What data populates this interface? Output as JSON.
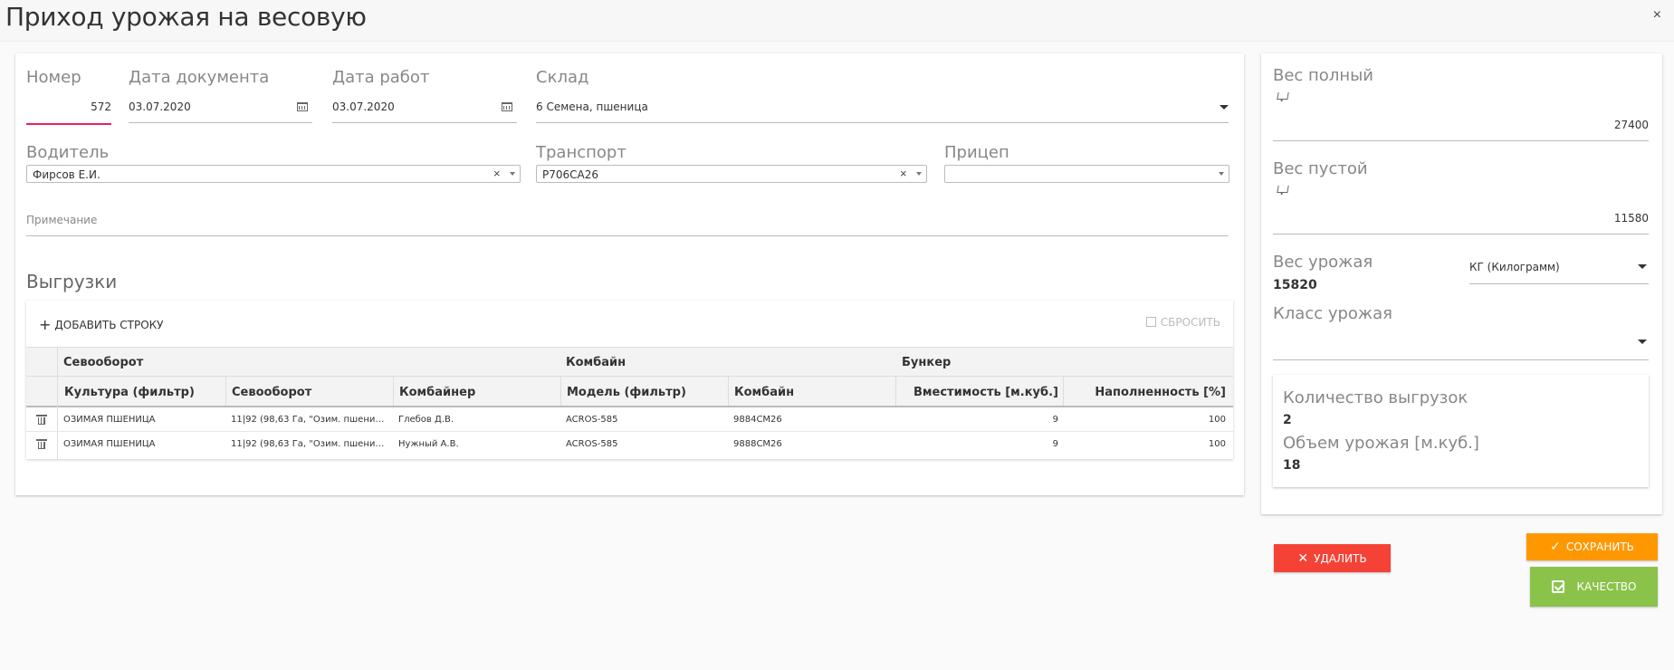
{
  "window": {
    "title": "Приход урожая на весовую",
    "close_label": "×"
  },
  "form": {
    "number": {
      "label": "Номер",
      "value": "572"
    },
    "doc_date": {
      "label": "Дата документа",
      "value": "03.07.2020"
    },
    "work_date": {
      "label": "Дата работ",
      "value": "03.07.2020"
    },
    "warehouse": {
      "label": "Склад",
      "value": "6 Семена, пшеница"
    },
    "driver": {
      "label": "Водитель",
      "value": "Фирсов Е.И."
    },
    "transport": {
      "label": "Транспорт",
      "value": "Р706СА26"
    },
    "trailer": {
      "label": "Прицеп",
      "value": ""
    },
    "note": {
      "label": "Примечание",
      "value": ""
    }
  },
  "unloads": {
    "title": "Выгрузки",
    "add_row_label": "ДОБАВИТЬ СТРОКУ",
    "reset_label": "СБРОСИТЬ",
    "group_headers": [
      "Севооборот",
      "Комбайн",
      "Бункер"
    ],
    "columns": [
      "Культура (фильтр)",
      "Севооборот",
      "Комбайнер",
      "Модель (фильтр)",
      "Комбайн",
      "Вместимость [м.куб.]",
      "Наполненность [%]"
    ],
    "rows": [
      [
        "ОЗИМАЯ ПШЕНИЦА",
        "11|92 (98,63 Га, \"Озим. пшеница 20...",
        "Глебов Д.В.",
        "ACROS-585",
        "9884СМ26",
        "9",
        "100"
      ],
      [
        "ОЗИМАЯ ПШЕНИЦА",
        "11|92 (98,63 Га, \"Озим. пшеница 20...",
        "Нужный А.В.",
        "ACROS-585",
        "9888СМ26",
        "9",
        "100"
      ]
    ]
  },
  "weights": {
    "full": {
      "label": "Вес полный",
      "value": "27400"
    },
    "empty": {
      "label": "Вес пустой",
      "value": "11580"
    },
    "harvest": {
      "label": "Вес урожая",
      "value": "15820",
      "unit": "КГ (Килограмм)"
    },
    "harvest_class": {
      "label": "Класс урожая",
      "value": ""
    }
  },
  "summary": {
    "count_label": "Количество выгрузок",
    "count_value": "2",
    "volume_label": "Объем урожая [м.куб.]",
    "volume_value": "18"
  },
  "buttons": {
    "delete": "УДАЛИТЬ",
    "save": "СОХРАНИТЬ",
    "quality": "КАЧЕСТВО"
  },
  "colors": {
    "delete": "#f44336",
    "save": "#ff9800",
    "quality": "#8bc34a",
    "focus": "#e91e63"
  }
}
